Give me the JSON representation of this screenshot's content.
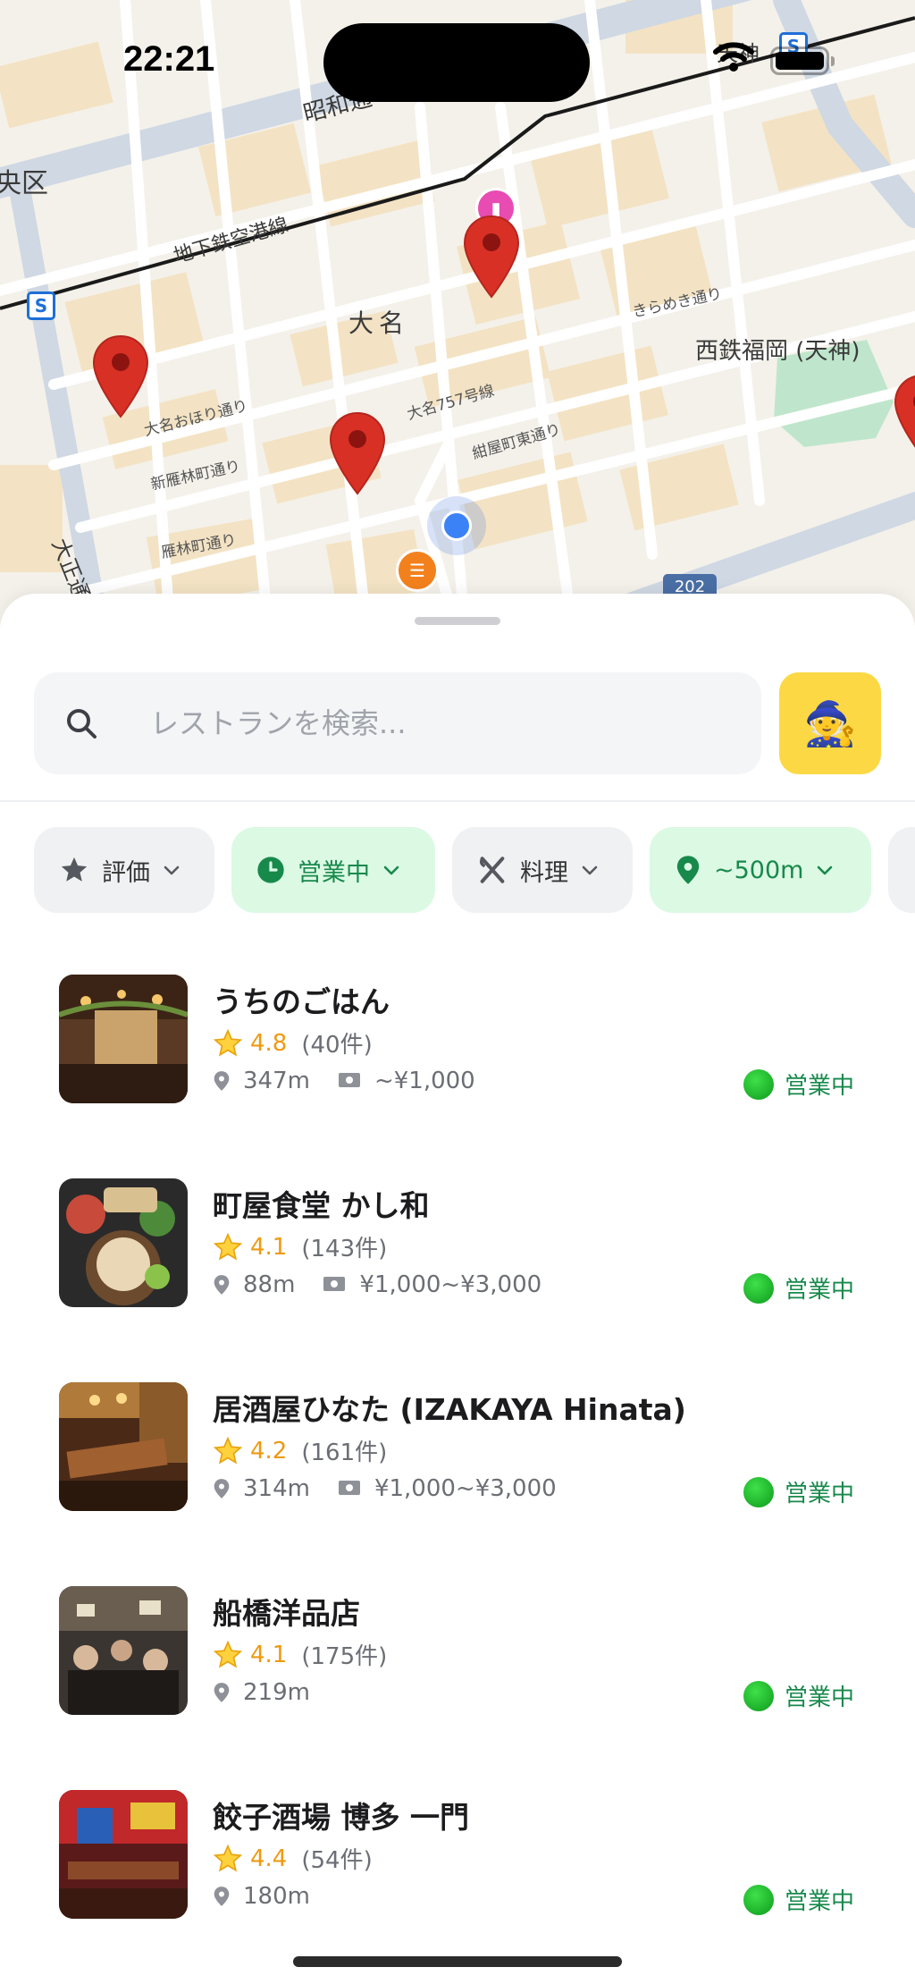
{
  "status_bar": {
    "time": "22:21"
  },
  "map": {
    "district_label": "央区",
    "area_label": "大名",
    "subway_line": "地下鉄空港線",
    "showa_street": "昭和通",
    "station_label": "西鉄福岡 (天神)",
    "street_kirameki": "きらめき通り",
    "street_daimyo757": "大名757号線",
    "street_oohori": "大名おほり通り",
    "street_shinkairin": "新雁林町通り",
    "street_konya": "紺屋町東通り",
    "street_kairin": "雁林町通り",
    "street_taisho": "大正通",
    "tenjin_label": "天神",
    "route_number": "202"
  },
  "search": {
    "placeholder": "レストランを検索..."
  },
  "filters": [
    {
      "label": "評価",
      "icon": "star-icon",
      "active": false
    },
    {
      "label": "営業中",
      "icon": "clock-icon",
      "active": true
    },
    {
      "label": "料理",
      "icon": "utensils-icon",
      "active": false
    },
    {
      "label": "~500m",
      "icon": "location-pin-icon",
      "active": true
    }
  ],
  "restaurants": [
    {
      "name": "うちのごはん",
      "rating": "4.8",
      "reviews": "(40件)",
      "distance": "347m",
      "price": "~¥1,000",
      "status": "営業中"
    },
    {
      "name": "町屋食堂 かし和",
      "rating": "4.1",
      "reviews": "(143件)",
      "distance": "88m",
      "price": "¥1,000~¥3,000",
      "status": "営業中"
    },
    {
      "name": "居酒屋ひなた (IZAKAYA Hinata)",
      "rating": "4.2",
      "reviews": "(161件)",
      "distance": "314m",
      "price": "¥1,000~¥3,000",
      "status": "営業中"
    },
    {
      "name": "船橋洋品店",
      "rating": "4.1",
      "reviews": "(175件)",
      "distance": "219m",
      "price": "",
      "status": "営業中"
    },
    {
      "name": "餃子酒場 博多 一門",
      "rating": "4.4",
      "reviews": "(54件)",
      "distance": "180m",
      "price": "",
      "status": "営業中"
    }
  ],
  "colors": {
    "accent_yellow": "#fcd944",
    "open_green": "#17894b",
    "chip_green_bg": "#dcf9e4",
    "rating_orange": "#ee9a11",
    "pin_red": "#d93025"
  }
}
